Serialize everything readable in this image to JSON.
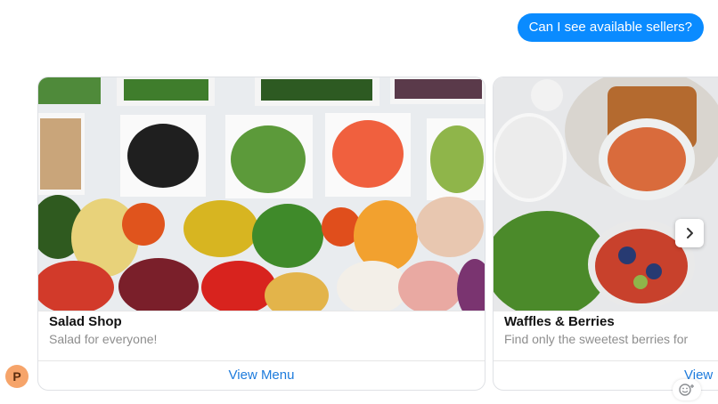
{
  "conversation": {
    "user_message": "Can I see available sellers?",
    "avatar_initial": "P"
  },
  "carousel": {
    "cards": [
      {
        "title": "Salad Shop",
        "subtitle": "Salad for everyone!",
        "action_label": "View Menu"
      },
      {
        "title": "Waffles & Berries",
        "subtitle": "Find only the sweetest berries for",
        "action_label": "View Menu"
      }
    ],
    "next_icon": "chevron-right-icon"
  },
  "reaction": {
    "icon": "add-reaction-icon"
  },
  "colors": {
    "user_bubble": "#0a8bff",
    "link": "#1d7bdc",
    "avatar": "#f6a46a"
  }
}
